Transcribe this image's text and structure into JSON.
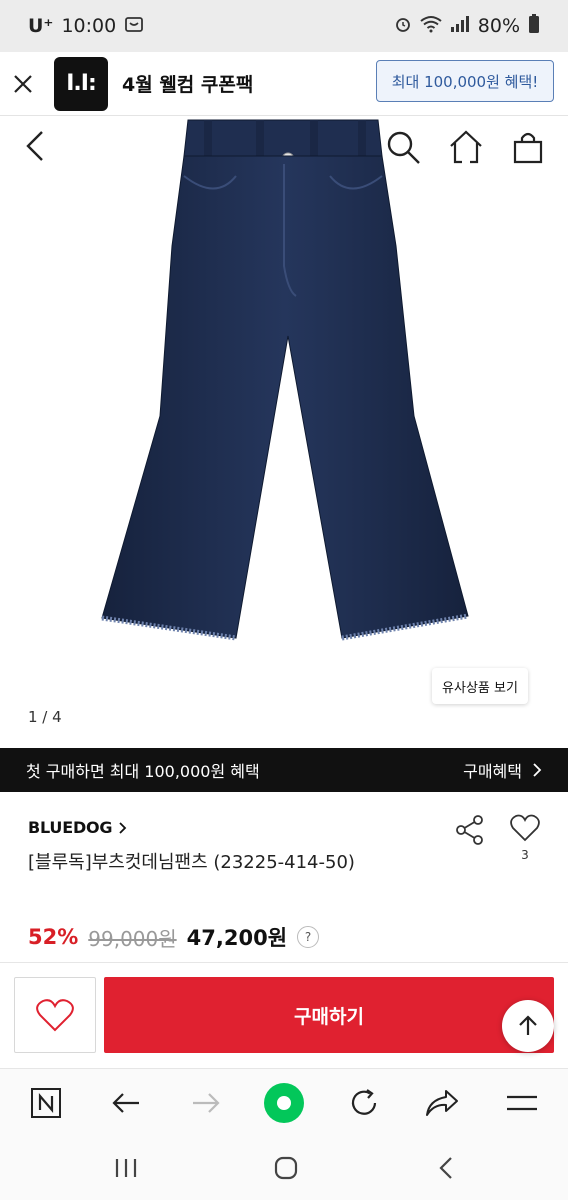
{
  "status_bar": {
    "carrier": "U⁺",
    "time": "10:00",
    "battery": "80%"
  },
  "app_banner": {
    "logo_text": "I.I:",
    "title": "4월 웰컴 쿠폰팩",
    "button_label": "최대 100,000원 혜택!"
  },
  "gallery": {
    "similar_label": "유사상품 보기",
    "page_indicator": "1 / 4"
  },
  "promo": {
    "text": "첫 구매하면 최대 100,000원 혜택",
    "link_label": "구매혜택"
  },
  "product": {
    "brand": "BLUEDOG",
    "name": "[블루독]부츠컷데님팬츠 (23225-414-50)",
    "wish_count": "3",
    "discount": "52%",
    "original_price": "99,000원",
    "sale_price": "47,200원",
    "help": "?"
  },
  "purchase_bar": {
    "buy_label": "구매하기"
  },
  "colors": {
    "accent_red": "#e02130",
    "denim": "#1e2d4e",
    "banner_blue": "#2f5a9d"
  },
  "icons": [
    "close-icon",
    "back-icon",
    "search-icon",
    "home-icon",
    "shopping-bag-icon",
    "share-icon",
    "heart-icon",
    "arrow-up-icon",
    "naver-icon",
    "arrow-left-icon",
    "arrow-right-icon",
    "green-dot-icon",
    "refresh-icon",
    "share-arrow-icon",
    "menu-icon",
    "recent-apps-icon",
    "home-circle-icon",
    "system-back-icon",
    "wifi-icon",
    "signal-icon",
    "alarm-icon",
    "battery-icon"
  ]
}
